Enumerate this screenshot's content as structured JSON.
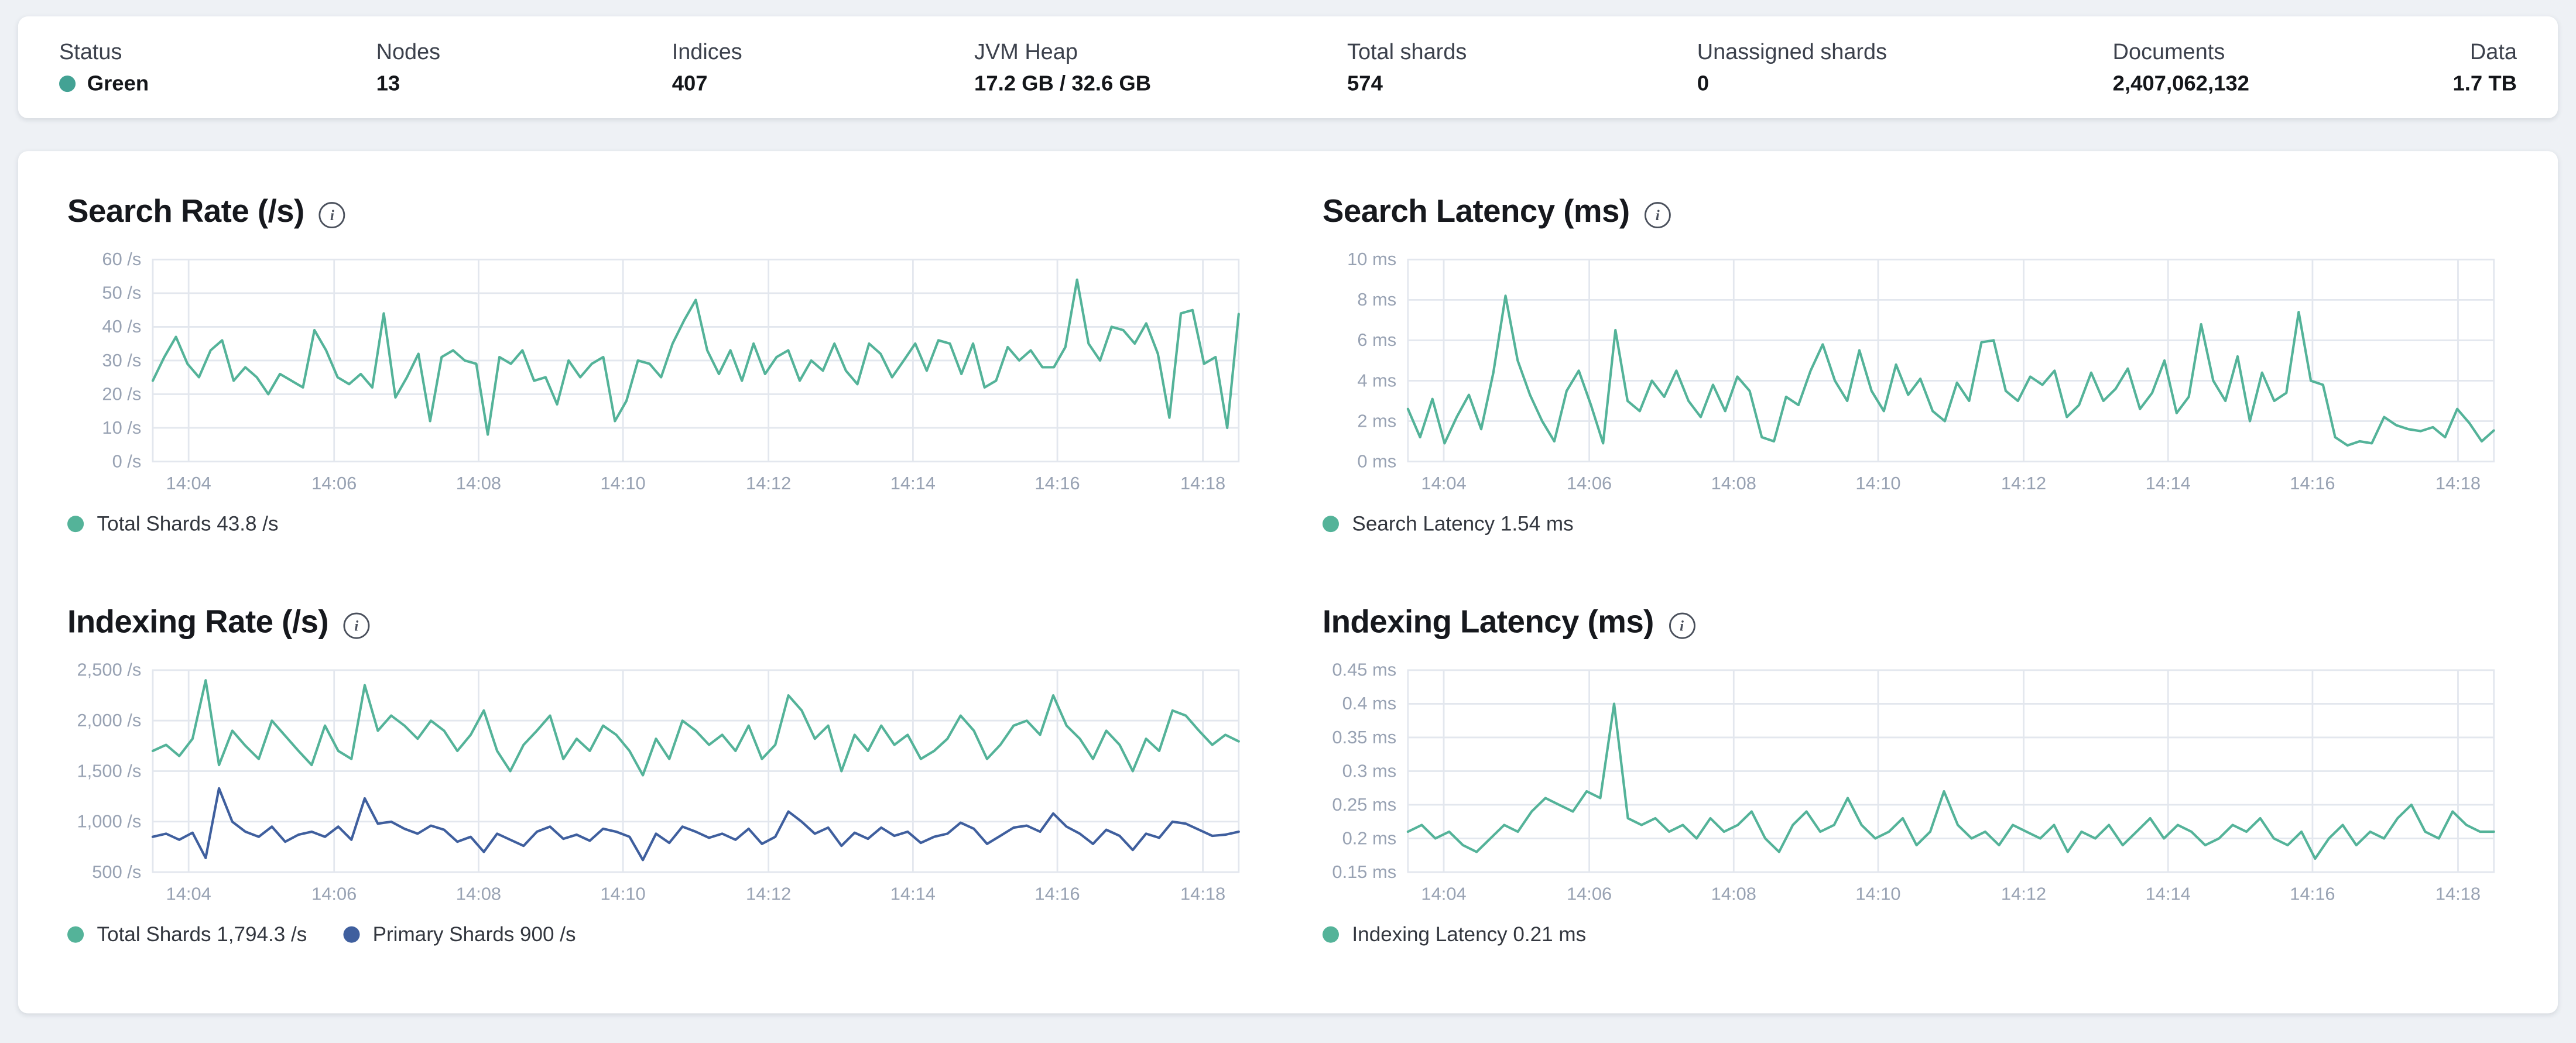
{
  "icons": {
    "info": "i"
  },
  "colors": {
    "teal": "#54b399",
    "blue": "#3f5f9e",
    "status_green_dot": "#43a294",
    "grid": "#e3e7ee"
  },
  "header": {
    "stats": [
      {
        "label": "Status",
        "value": "Green"
      },
      {
        "label": "Nodes",
        "value": "13"
      },
      {
        "label": "Indices",
        "value": "407"
      },
      {
        "label": "JVM Heap",
        "value": "17.2 GB / 32.6 GB"
      },
      {
        "label": "Total shards",
        "value": "574"
      },
      {
        "label": "Unassigned shards",
        "value": "0"
      },
      {
        "label": "Documents",
        "value": "2,407,062,132"
      },
      {
        "label": "Data",
        "value": "1.7 TB"
      }
    ]
  },
  "chart_data": [
    {
      "type": "line",
      "title": "Search Rate (/s)",
      "ylabel": "/s",
      "ylim": [
        0,
        60
      ],
      "yticks": {
        "values": [
          0,
          10,
          20,
          30,
          40,
          50,
          60
        ],
        "labels": [
          "0 /s",
          "10 /s",
          "20 /s",
          "30 /s",
          "40 /s",
          "50 /s",
          "60 /s"
        ]
      },
      "xticks": {
        "fracs": [
          0.033,
          0.167,
          0.3,
          0.433,
          0.567,
          0.7,
          0.833,
          0.967
        ],
        "labels": [
          "14:04",
          "14:06",
          "14:08",
          "14:10",
          "14:12",
          "14:14",
          "14:16",
          "14:18"
        ]
      },
      "series": [
        {
          "name": "Total Shards",
          "color": "#54b399",
          "values": [
            24,
            31,
            37,
            29,
            25,
            33,
            36,
            24,
            28,
            25,
            20,
            26,
            24,
            22,
            39,
            33,
            25,
            23,
            26,
            22,
            44,
            19,
            25,
            32,
            12,
            31,
            33,
            30,
            29,
            8,
            31,
            29,
            33,
            24,
            25,
            17,
            30,
            25,
            29,
            31,
            12,
            18,
            30,
            29,
            25,
            35,
            42,
            48,
            33,
            26,
            33,
            24,
            35,
            26,
            31,
            33,
            24,
            30,
            27,
            35,
            27,
            23,
            35,
            32,
            25,
            30,
            35,
            27,
            36,
            35,
            26,
            35,
            22,
            24,
            34,
            30,
            33,
            28,
            28,
            34,
            54,
            35,
            30,
            40,
            39,
            35,
            41,
            32,
            13,
            44,
            45,
            29,
            31,
            10,
            43.8
          ]
        }
      ],
      "legend": [
        {
          "label": "Total Shards 43.8 /s",
          "color": "#54b399"
        }
      ]
    },
    {
      "type": "line",
      "title": "Search Latency (ms)",
      "ylabel": "ms",
      "ylim": [
        0,
        10
      ],
      "yticks": {
        "values": [
          0,
          2,
          4,
          6,
          8,
          10
        ],
        "labels": [
          "0 ms",
          "2 ms",
          "4 ms",
          "6 ms",
          "8 ms",
          "10 ms"
        ]
      },
      "xticks": {
        "fracs": [
          0.033,
          0.167,
          0.3,
          0.433,
          0.567,
          0.7,
          0.833,
          0.967
        ],
        "labels": [
          "14:04",
          "14:06",
          "14:08",
          "14:10",
          "14:12",
          "14:14",
          "14:16",
          "14:18"
        ]
      },
      "series": [
        {
          "name": "Search Latency",
          "color": "#54b399",
          "values": [
            2.6,
            1.2,
            3.1,
            0.9,
            2.2,
            3.3,
            1.6,
            4.4,
            8.2,
            5.0,
            3.3,
            2.0,
            1.0,
            3.5,
            4.5,
            2.8,
            0.9,
            6.5,
            3.0,
            2.5,
            4.0,
            3.2,
            4.5,
            3.0,
            2.2,
            3.8,
            2.5,
            4.2,
            3.5,
            1.2,
            1.0,
            3.2,
            2.8,
            4.5,
            5.8,
            4.0,
            3.0,
            5.5,
            3.5,
            2.5,
            4.8,
            3.3,
            4.1,
            2.5,
            2.0,
            3.9,
            3.0,
            5.9,
            6.0,
            3.5,
            3.0,
            4.2,
            3.8,
            4.5,
            2.2,
            2.8,
            4.4,
            3.0,
            3.6,
            4.6,
            2.6,
            3.4,
            5.0,
            2.4,
            3.2,
            6.8,
            4.0,
            3.0,
            5.2,
            2.0,
            4.4,
            3.0,
            3.4,
            7.4,
            4.0,
            3.8,
            1.2,
            0.8,
            1.0,
            0.9,
            2.2,
            1.8,
            1.6,
            1.5,
            1.7,
            1.2,
            2.6,
            1.9,
            1.0,
            1.54
          ]
        }
      ],
      "legend": [
        {
          "label": "Search Latency 1.54 ms",
          "color": "#54b399"
        }
      ]
    },
    {
      "type": "line",
      "title": "Indexing Rate (/s)",
      "ylabel": "/s",
      "ylim": [
        500,
        2500
      ],
      "yticks": {
        "values": [
          500,
          1000,
          1500,
          2000,
          2500
        ],
        "labels": [
          "500 /s",
          "1,000 /s",
          "1,500 /s",
          "2,000 /s",
          "2,500 /s"
        ]
      },
      "xticks": {
        "fracs": [
          0.033,
          0.167,
          0.3,
          0.433,
          0.567,
          0.7,
          0.833,
          0.967
        ],
        "labels": [
          "14:04",
          "14:06",
          "14:08",
          "14:10",
          "14:12",
          "14:14",
          "14:16",
          "14:18"
        ]
      },
      "series": [
        {
          "name": "Total Shards",
          "color": "#54b399",
          "values": [
            1700,
            1760,
            1650,
            1820,
            2400,
            1560,
            1900,
            1750,
            1620,
            2000,
            1850,
            1700,
            1560,
            1950,
            1700,
            1620,
            2350,
            1900,
            2050,
            1950,
            1820,
            2000,
            1900,
            1700,
            1860,
            2100,
            1700,
            1500,
            1760,
            1900,
            2050,
            1620,
            1820,
            1700,
            1950,
            1860,
            1700,
            1460,
            1820,
            1620,
            2000,
            1900,
            1760,
            1860,
            1700,
            1950,
            1620,
            1760,
            2250,
            2100,
            1820,
            1950,
            1500,
            1860,
            1700,
            1950,
            1760,
            1860,
            1620,
            1700,
            1820,
            2050,
            1900,
            1620,
            1760,
            1950,
            2000,
            1860,
            2250,
            1950,
            1820,
            1620,
            1900,
            1760,
            1500,
            1820,
            1700,
            2100,
            2050,
            1900,
            1760,
            1860,
            1794.3
          ]
        },
        {
          "name": "Primary Shards",
          "color": "#3f5f9e",
          "values": [
            850,
            880,
            820,
            890,
            640,
            1330,
            1000,
            900,
            850,
            950,
            800,
            870,
            900,
            850,
            950,
            820,
            1230,
            980,
            1000,
            930,
            880,
            960,
            920,
            800,
            850,
            700,
            880,
            820,
            760,
            900,
            950,
            830,
            870,
            810,
            930,
            900,
            850,
            620,
            880,
            790,
            950,
            900,
            840,
            880,
            820,
            930,
            780,
            850,
            1100,
            1000,
            880,
            940,
            760,
            890,
            830,
            940,
            860,
            900,
            790,
            850,
            880,
            990,
            930,
            780,
            860,
            940,
            960,
            900,
            1080,
            950,
            880,
            780,
            920,
            860,
            720,
            880,
            840,
            1000,
            980,
            920,
            860,
            870,
            900
          ]
        }
      ],
      "legend": [
        {
          "label": "Total Shards 1,794.3 /s",
          "color": "#54b399"
        },
        {
          "label": "Primary Shards 900 /s",
          "color": "#3f5f9e"
        }
      ]
    },
    {
      "type": "line",
      "title": "Indexing Latency (ms)",
      "ylabel": "ms",
      "ylim": [
        0.15,
        0.45
      ],
      "yticks": {
        "values": [
          0.15,
          0.2,
          0.25,
          0.3,
          0.35,
          0.4,
          0.45
        ],
        "labels": [
          "0.15 ms",
          "0.2 ms",
          "0.25 ms",
          "0.3 ms",
          "0.35 ms",
          "0.4 ms",
          "0.45 ms"
        ]
      },
      "xticks": {
        "fracs": [
          0.033,
          0.167,
          0.3,
          0.433,
          0.567,
          0.7,
          0.833,
          0.967
        ],
        "labels": [
          "14:04",
          "14:06",
          "14:08",
          "14:10",
          "14:12",
          "14:14",
          "14:16",
          "14:18"
        ]
      },
      "series": [
        {
          "name": "Indexing Latency",
          "color": "#54b399",
          "values": [
            0.21,
            0.22,
            0.2,
            0.21,
            0.19,
            0.18,
            0.2,
            0.22,
            0.21,
            0.24,
            0.26,
            0.25,
            0.24,
            0.27,
            0.26,
            0.4,
            0.23,
            0.22,
            0.23,
            0.21,
            0.22,
            0.2,
            0.23,
            0.21,
            0.22,
            0.24,
            0.2,
            0.18,
            0.22,
            0.24,
            0.21,
            0.22,
            0.26,
            0.22,
            0.2,
            0.21,
            0.23,
            0.19,
            0.21,
            0.27,
            0.22,
            0.2,
            0.21,
            0.19,
            0.22,
            0.21,
            0.2,
            0.22,
            0.18,
            0.21,
            0.2,
            0.22,
            0.19,
            0.21,
            0.23,
            0.2,
            0.22,
            0.21,
            0.19,
            0.2,
            0.22,
            0.21,
            0.23,
            0.2,
            0.19,
            0.21,
            0.17,
            0.2,
            0.22,
            0.19,
            0.21,
            0.2,
            0.23,
            0.25,
            0.21,
            0.2,
            0.24,
            0.22,
            0.21,
            0.21
          ]
        }
      ],
      "legend": [
        {
          "label": "Indexing Latency 0.21 ms",
          "color": "#54b399"
        }
      ]
    }
  ]
}
